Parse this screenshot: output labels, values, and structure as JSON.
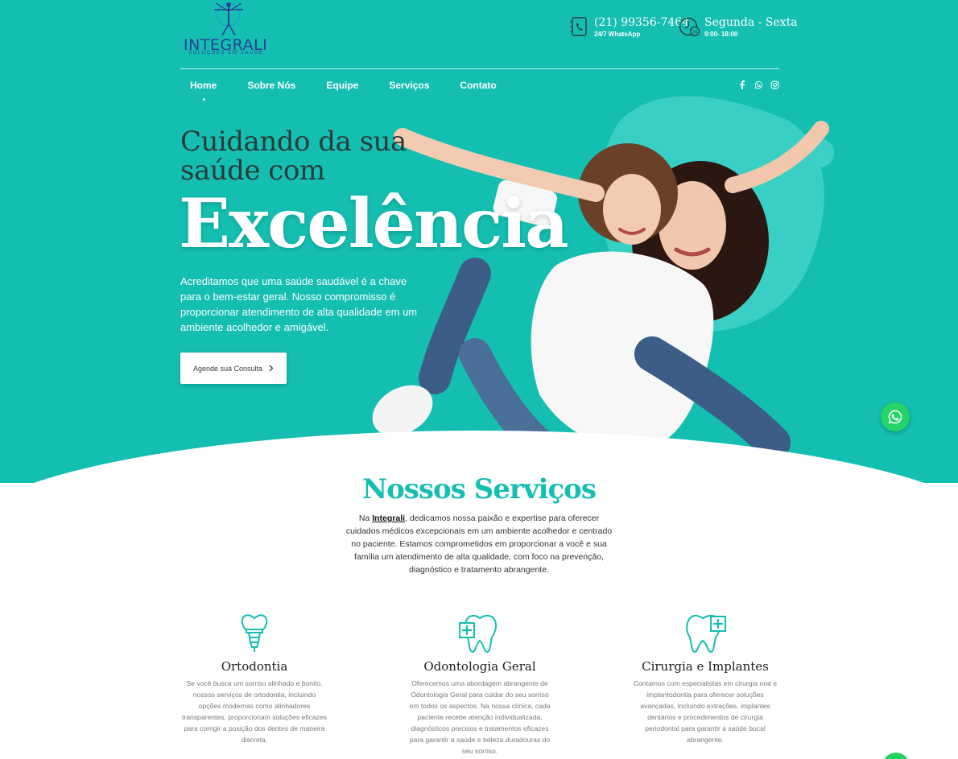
{
  "colors": {
    "primary": "#14bfb1",
    "logo": "#2a3f96",
    "whatsapp": "#25d366"
  },
  "logo": {
    "name": "INTEGRALI",
    "tagline": "SOLUÇÕES EM SAÚDE"
  },
  "contact": {
    "phone": "(21) 99356-7464",
    "phone_sub": "24/7 WhatsApp",
    "phone_icon": "phone-book-icon",
    "hours": "Segunda - Sexta",
    "hours_sub": "9:00- 18:00",
    "hours_icon": "clock-24-icon"
  },
  "nav": {
    "items": [
      {
        "label": "Home"
      },
      {
        "label": "Sobre Nós"
      },
      {
        "label": "Equipe"
      },
      {
        "label": "Serviços"
      },
      {
        "label": "Contato"
      }
    ],
    "social": [
      "facebook-icon",
      "whatsapp-icon",
      "instagram-icon"
    ]
  },
  "hero": {
    "line1": "Cuidando da sua",
    "line2": "saúde com",
    "highlight": "Excelência",
    "description": "Acreditamos que uma saúde saudável é a chave para o bem-estar geral. Nosso compromisso é proporcionar atendimento de alta qualidade em um ambiente acolhedor e amigável.",
    "cta": "Agende sua Consulta"
  },
  "services_section": {
    "title": "Nossos Serviços",
    "intro_before": "Na ",
    "intro_brand": "Integrali",
    "intro_after": ", dedicamos nossa paixão e expertise para oferecer cuidados médicos excepcionais em um ambiente acolhedor e centrado no paciente. Estamos comprometidos em proporcionar a você e sua família um atendimento de alta qualidade, com foco na prevenção, diagnóstico e tratamento abrangente.",
    "items": [
      {
        "icon": "tooth-implant-icon",
        "title": "Ortodontia",
        "text": "Se você busca um sorriso alinhado e bonito, nossos serviços de ortodontia, incluindo opções modernas como alinhadores transparentes, proporcionam soluções eficazes para corrigir a posição dos dentes de maneira discreta."
      },
      {
        "icon": "tooth-cross-icon",
        "title": "Odontologia Geral",
        "text": "Oferecemos uma abordagem abrangente de Odontologia Geral para cuidar do seu sorriso em todos os aspectos. Na nossa clínica, cada paciente recebe atenção individualizada, diagnósticos precisos e tratamentos eficazes para garantir a saúde e beleza duradouras do seu sorriso."
      },
      {
        "icon": "tooth-plus-icon",
        "title": "Cirurgia e Implantes",
        "text": "Contamos com especialistas em cirurgia oral e implantodontia para oferecer soluções avançadas, incluindo extrações, implantes dentários e procedimentos de cirurgia periodontal para garantir a saúde bucal abrangente."
      }
    ]
  }
}
